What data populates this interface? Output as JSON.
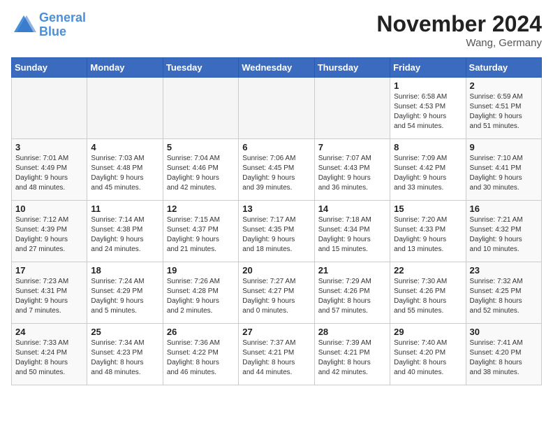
{
  "header": {
    "logo_line1": "General",
    "logo_line2": "Blue",
    "month": "November 2024",
    "location": "Wang, Germany"
  },
  "weekdays": [
    "Sunday",
    "Monday",
    "Tuesday",
    "Wednesday",
    "Thursday",
    "Friday",
    "Saturday"
  ],
  "weeks": [
    [
      {
        "day": "",
        "info": ""
      },
      {
        "day": "",
        "info": ""
      },
      {
        "day": "",
        "info": ""
      },
      {
        "day": "",
        "info": ""
      },
      {
        "day": "",
        "info": ""
      },
      {
        "day": "1",
        "info": "Sunrise: 6:58 AM\nSunset: 4:53 PM\nDaylight: 9 hours\nand 54 minutes."
      },
      {
        "day": "2",
        "info": "Sunrise: 6:59 AM\nSunset: 4:51 PM\nDaylight: 9 hours\nand 51 minutes."
      }
    ],
    [
      {
        "day": "3",
        "info": "Sunrise: 7:01 AM\nSunset: 4:49 PM\nDaylight: 9 hours\nand 48 minutes."
      },
      {
        "day": "4",
        "info": "Sunrise: 7:03 AM\nSunset: 4:48 PM\nDaylight: 9 hours\nand 45 minutes."
      },
      {
        "day": "5",
        "info": "Sunrise: 7:04 AM\nSunset: 4:46 PM\nDaylight: 9 hours\nand 42 minutes."
      },
      {
        "day": "6",
        "info": "Sunrise: 7:06 AM\nSunset: 4:45 PM\nDaylight: 9 hours\nand 39 minutes."
      },
      {
        "day": "7",
        "info": "Sunrise: 7:07 AM\nSunset: 4:43 PM\nDaylight: 9 hours\nand 36 minutes."
      },
      {
        "day": "8",
        "info": "Sunrise: 7:09 AM\nSunset: 4:42 PM\nDaylight: 9 hours\nand 33 minutes."
      },
      {
        "day": "9",
        "info": "Sunrise: 7:10 AM\nSunset: 4:41 PM\nDaylight: 9 hours\nand 30 minutes."
      }
    ],
    [
      {
        "day": "10",
        "info": "Sunrise: 7:12 AM\nSunset: 4:39 PM\nDaylight: 9 hours\nand 27 minutes."
      },
      {
        "day": "11",
        "info": "Sunrise: 7:14 AM\nSunset: 4:38 PM\nDaylight: 9 hours\nand 24 minutes."
      },
      {
        "day": "12",
        "info": "Sunrise: 7:15 AM\nSunset: 4:37 PM\nDaylight: 9 hours\nand 21 minutes."
      },
      {
        "day": "13",
        "info": "Sunrise: 7:17 AM\nSunset: 4:35 PM\nDaylight: 9 hours\nand 18 minutes."
      },
      {
        "day": "14",
        "info": "Sunrise: 7:18 AM\nSunset: 4:34 PM\nDaylight: 9 hours\nand 15 minutes."
      },
      {
        "day": "15",
        "info": "Sunrise: 7:20 AM\nSunset: 4:33 PM\nDaylight: 9 hours\nand 13 minutes."
      },
      {
        "day": "16",
        "info": "Sunrise: 7:21 AM\nSunset: 4:32 PM\nDaylight: 9 hours\nand 10 minutes."
      }
    ],
    [
      {
        "day": "17",
        "info": "Sunrise: 7:23 AM\nSunset: 4:31 PM\nDaylight: 9 hours\nand 7 minutes."
      },
      {
        "day": "18",
        "info": "Sunrise: 7:24 AM\nSunset: 4:29 PM\nDaylight: 9 hours\nand 5 minutes."
      },
      {
        "day": "19",
        "info": "Sunrise: 7:26 AM\nSunset: 4:28 PM\nDaylight: 9 hours\nand 2 minutes."
      },
      {
        "day": "20",
        "info": "Sunrise: 7:27 AM\nSunset: 4:27 PM\nDaylight: 9 hours\nand 0 minutes."
      },
      {
        "day": "21",
        "info": "Sunrise: 7:29 AM\nSunset: 4:26 PM\nDaylight: 8 hours\nand 57 minutes."
      },
      {
        "day": "22",
        "info": "Sunrise: 7:30 AM\nSunset: 4:26 PM\nDaylight: 8 hours\nand 55 minutes."
      },
      {
        "day": "23",
        "info": "Sunrise: 7:32 AM\nSunset: 4:25 PM\nDaylight: 8 hours\nand 52 minutes."
      }
    ],
    [
      {
        "day": "24",
        "info": "Sunrise: 7:33 AM\nSunset: 4:24 PM\nDaylight: 8 hours\nand 50 minutes."
      },
      {
        "day": "25",
        "info": "Sunrise: 7:34 AM\nSunset: 4:23 PM\nDaylight: 8 hours\nand 48 minutes."
      },
      {
        "day": "26",
        "info": "Sunrise: 7:36 AM\nSunset: 4:22 PM\nDaylight: 8 hours\nand 46 minutes."
      },
      {
        "day": "27",
        "info": "Sunrise: 7:37 AM\nSunset: 4:21 PM\nDaylight: 8 hours\nand 44 minutes."
      },
      {
        "day": "28",
        "info": "Sunrise: 7:39 AM\nSunset: 4:21 PM\nDaylight: 8 hours\nand 42 minutes."
      },
      {
        "day": "29",
        "info": "Sunrise: 7:40 AM\nSunset: 4:20 PM\nDaylight: 8 hours\nand 40 minutes."
      },
      {
        "day": "30",
        "info": "Sunrise: 7:41 AM\nSunset: 4:20 PM\nDaylight: 8 hours\nand 38 minutes."
      }
    ]
  ]
}
